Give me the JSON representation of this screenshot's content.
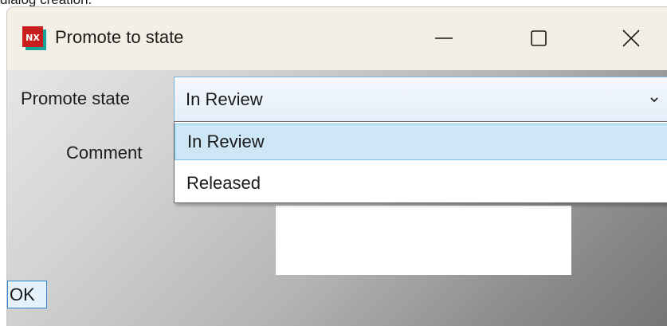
{
  "top_caption": "dialog creation.",
  "window": {
    "title": "Promote to state",
    "icon_text": "NX",
    "controls": [
      "minimize-icon",
      "maximize-icon",
      "close-icon"
    ]
  },
  "form": {
    "promote_state_label": "Promote state",
    "promote_state_selected": "In Review",
    "promote_state_options": [
      "In Review",
      "Released"
    ],
    "comment_label": "Comment",
    "ok_label": "OK"
  },
  "colors": {
    "titlebar": "#f3efe4",
    "selection": "#cde7f7",
    "accent_border": "#2f86d6",
    "app_icon_red": "#c81e1e",
    "app_icon_teal": "#1aa398"
  }
}
